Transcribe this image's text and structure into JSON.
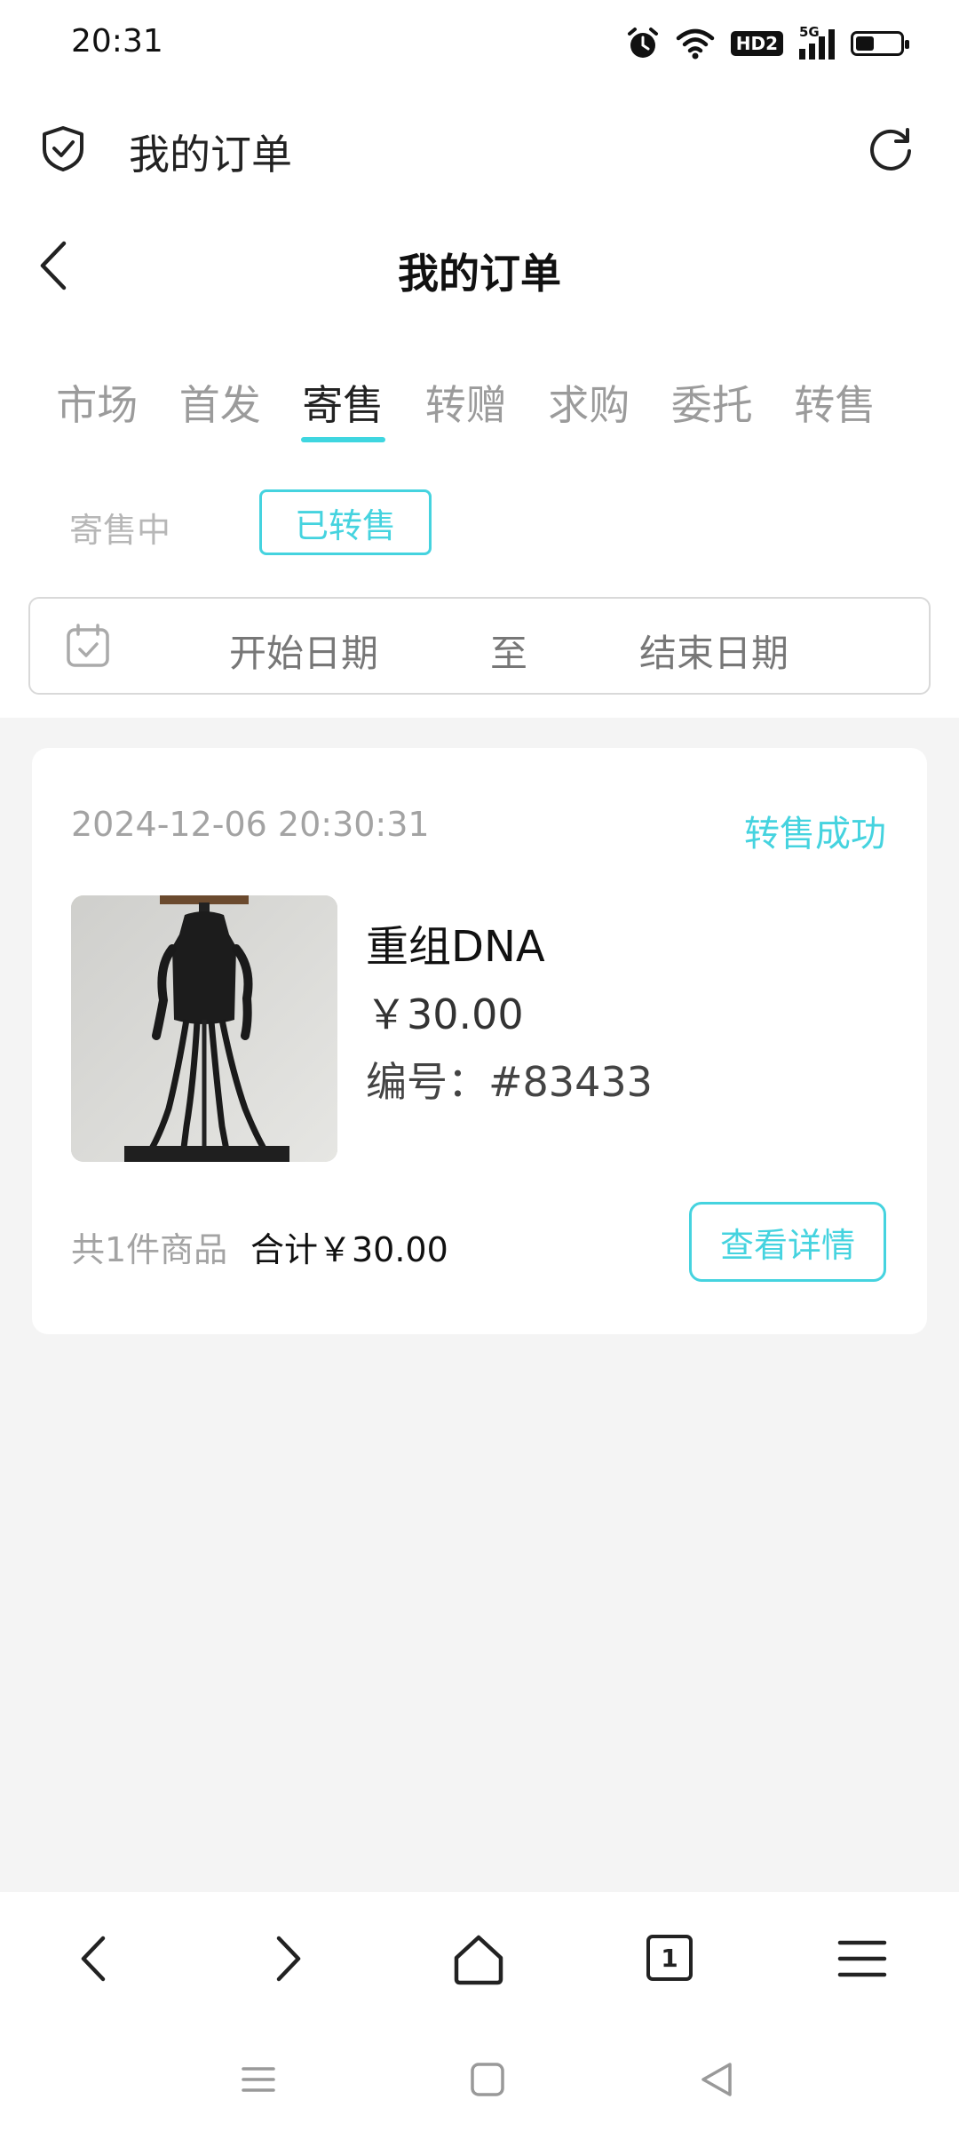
{
  "status_bar": {
    "time": "20:31",
    "icons": [
      "alarm-icon",
      "wifi-icon",
      "hd-icon",
      "signal-5g-icon",
      "battery-icon"
    ],
    "hd_label": "HD2",
    "network_label": "5G"
  },
  "browser": {
    "title": "我的订单",
    "tab_count": "1"
  },
  "page": {
    "title": "我的订单"
  },
  "tabs": [
    {
      "label": "市场",
      "active": false
    },
    {
      "label": "首发",
      "active": false
    },
    {
      "label": "寄售",
      "active": true
    },
    {
      "label": "转赠",
      "active": false
    },
    {
      "label": "求购",
      "active": false
    },
    {
      "label": "委托",
      "active": false
    },
    {
      "label": "转售",
      "active": false
    }
  ],
  "subtabs": [
    {
      "label": "寄售中",
      "active": false
    },
    {
      "label": "已转售",
      "active": true
    }
  ],
  "date_filter": {
    "start_placeholder": "开始日期",
    "separator": "至",
    "end_placeholder": "结束日期"
  },
  "orders": [
    {
      "time": "2024-12-06 20:30:31",
      "status": "转售成功",
      "product_name": "重组DNA",
      "price": "￥30.00",
      "serial": "编号：#83433",
      "count_text": "共1件商品",
      "total_text": "合计￥30.00",
      "detail_label": "查看详情"
    }
  ],
  "colors": {
    "accent": "#45d3df",
    "list_background": "#f4f4f4"
  }
}
